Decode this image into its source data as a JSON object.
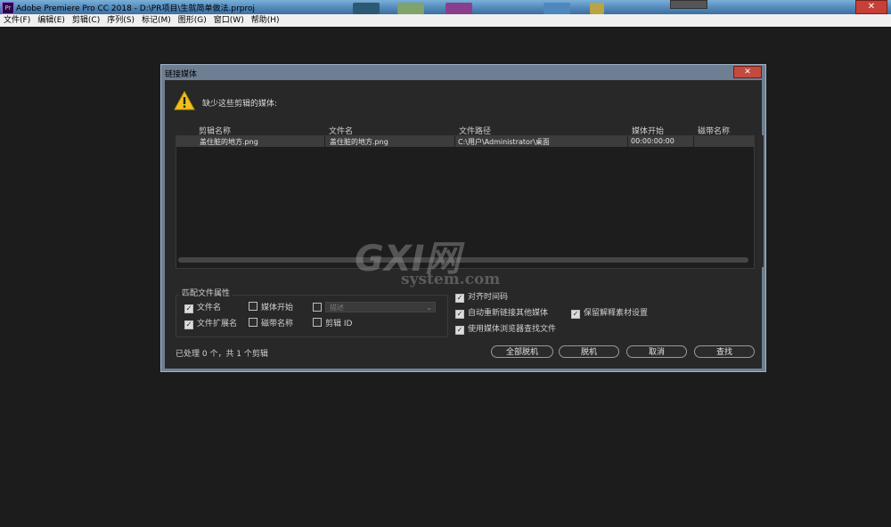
{
  "app": {
    "icon_text": "Pr",
    "title": "Adobe Premiere Pro CC 2018 - D:\\PR项目\\生就简单做法.prproj",
    "close_glyph": "✕"
  },
  "menu": [
    "文件(F)",
    "编辑(E)",
    "剪辑(C)",
    "序列(S)",
    "标记(M)",
    "图形(G)",
    "窗口(W)",
    "帮助(H)"
  ],
  "dialog": {
    "title": "链接媒体",
    "close_glyph": "✕",
    "warning_icon": "warning-triangle-icon",
    "warning_text": "缺少这些剪辑的媒体:",
    "columns": [
      "剪辑名称",
      "文件名",
      "文件路径",
      "媒体开始",
      "磁带名称"
    ],
    "rows": [
      {
        "clip": "盖住脏的地方.png",
        "file": "盖住脏的地方.png",
        "path": "C:\\用户\\Administrator\\桌面",
        "start": "00:00:00:00",
        "tape": ""
      }
    ],
    "match_title": "匹配文件属性",
    "match": {
      "filename": {
        "label": "文件名",
        "checked": true
      },
      "media_start": {
        "label": "媒体开始",
        "checked": false
      },
      "desc": {
        "label": "",
        "checked": false
      },
      "extension": {
        "label": "文件扩展名",
        "checked": true
      },
      "tape_name": {
        "label": "磁带名称",
        "checked": false
      },
      "clip_id": {
        "label": "剪辑 ID",
        "checked": false
      }
    },
    "dropdown_value": "描述",
    "options": {
      "align_timecode": {
        "label": "对齐时间码",
        "checked": true
      },
      "relink_others": {
        "label": "自动重新链接其他媒体",
        "checked": true
      },
      "preserve_interpret": {
        "label": "保留解释素材设置",
        "checked": true
      },
      "use_browser": {
        "label": "使用媒体浏览器查找文件",
        "checked": true
      }
    },
    "status": "已处理 0 个，共 1 个剪辑",
    "buttons": {
      "offline_all": "全部脱机",
      "offline": "脱机",
      "cancel": "取消",
      "locate": "查找"
    }
  },
  "watermark": {
    "big": "GXI网",
    "small": "system.com"
  }
}
